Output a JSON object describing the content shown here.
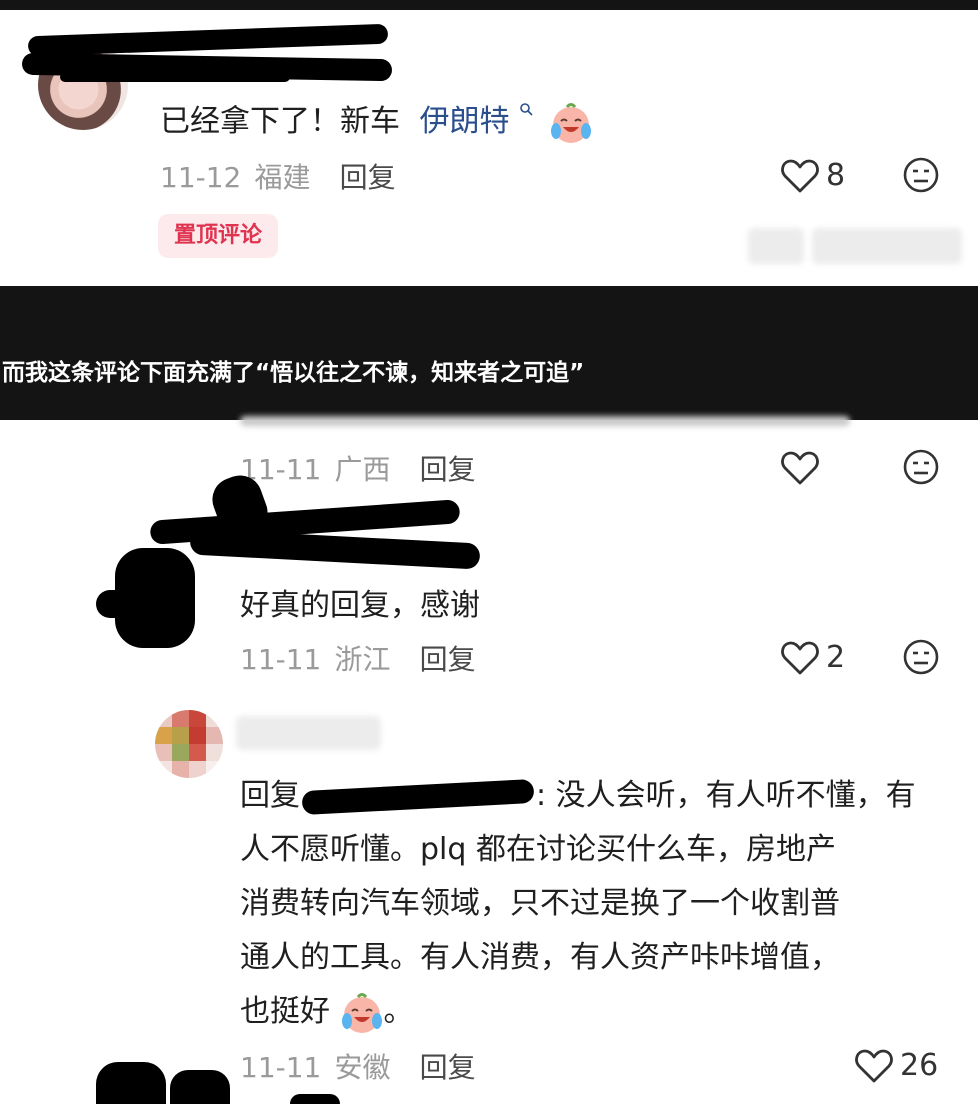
{
  "comment_main": {
    "text": "已经拿下了！新车",
    "link": "伊朗特",
    "date": "11-12",
    "location": "福建",
    "reply_label": "回复",
    "likes": "8",
    "badge": "置顶评论"
  },
  "overlay_caption": "而我这条评论下面充满了“悟以往之不谏，知来者之可追”",
  "reply1": {
    "date": "11-11",
    "location": "广西",
    "reply_label": "回复"
  },
  "reply2": {
    "text": "好真的回复，感谢",
    "date": "11-11",
    "location": "浙江",
    "reply_label": "回复",
    "likes": "2"
  },
  "reply3": {
    "prefix": "回复",
    "lines": [
      ": 没人会听，有人听不懂，有",
      "人不愿听懂。plq 都在讨论买什么车，房地产",
      "消费转向汽车领域，只不过是换了一个收割普",
      "通人的工具。有人消费，有人资产咔咔增值，",
      "也挺好"
    ],
    "end": "。",
    "date": "11-11",
    "location": "安徽",
    "reply_label": "回复",
    "likes": "26"
  },
  "icons": {
    "heart": "heart-outline-icon",
    "dislike": "meh-face-icon",
    "search": "search-icon",
    "emoji": "crying-laughing-emoji"
  },
  "colors": {
    "badge_bg": "#fdeaec",
    "badge_text": "#e0334f",
    "link": "#2b4f8c",
    "meta": "#9a9a9a"
  }
}
